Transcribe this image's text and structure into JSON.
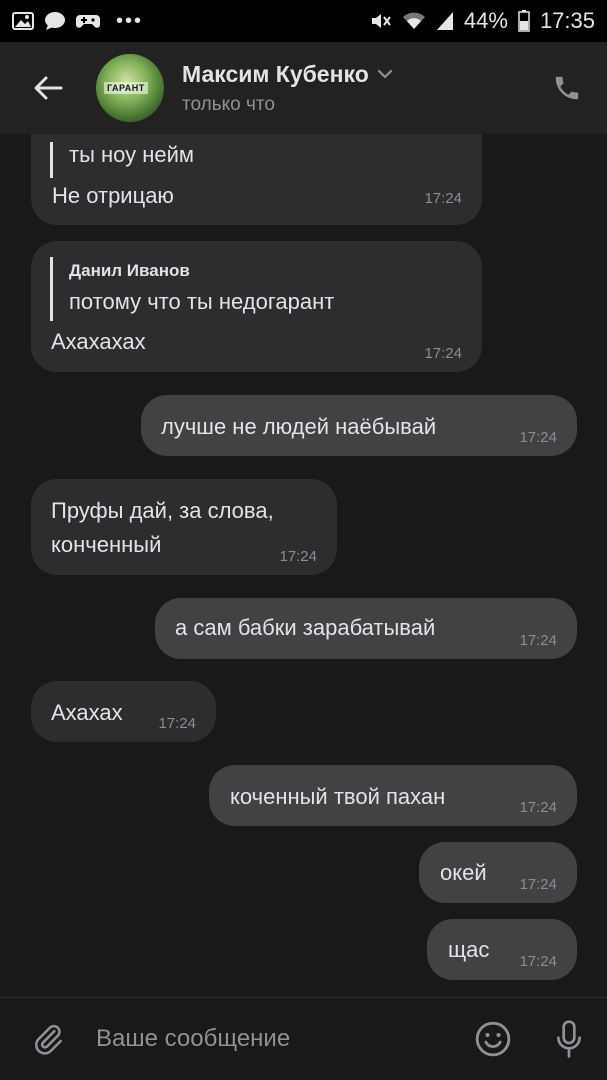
{
  "status_bar": {
    "left_icons": [
      "gallery-icon",
      "chat-bubble-icon",
      "game-controller-icon"
    ],
    "dots": "•••",
    "battery_percent": "44%",
    "time": "17:35"
  },
  "header": {
    "contact_name": "Максим Кубенко",
    "status": "только что",
    "avatar_text": "ГАРАНТ"
  },
  "messages": [
    {
      "direction": "incoming",
      "quote_text": "ты ноу нейм",
      "text": "Не отрицаю",
      "time": "17:24"
    },
    {
      "direction": "incoming",
      "quote_author": "Данил Иванов",
      "quote_text": "потому что ты недогарант",
      "text": "Ахахахах",
      "time": "17:24"
    },
    {
      "direction": "outgoing",
      "text": "лучше не людей наёбывай",
      "time": "17:24"
    },
    {
      "direction": "incoming",
      "text_line1": "Пруфы дай, за слова,",
      "text_line2": "конченный",
      "time": "17:24"
    },
    {
      "direction": "outgoing",
      "text": "а сам бабки зарабатывай",
      "time": "17:24"
    },
    {
      "direction": "incoming",
      "text": "Ахахах",
      "time": "17:24"
    },
    {
      "direction": "outgoing",
      "text": "коченный твой пахан",
      "time": "17:24"
    },
    {
      "direction": "outgoing",
      "text": "окей",
      "time": "17:24"
    },
    {
      "direction": "outgoing",
      "text": "щас",
      "time": "17:24"
    }
  ],
  "composer": {
    "placeholder": "Ваше сообщение"
  },
  "colors": {
    "background": "#19191a",
    "header": "#222223",
    "incoming_bubble": "#2c2d2f",
    "outgoing_bubble": "#414244",
    "text": "#e1e3e6",
    "secondary_text": "#8e9196"
  }
}
